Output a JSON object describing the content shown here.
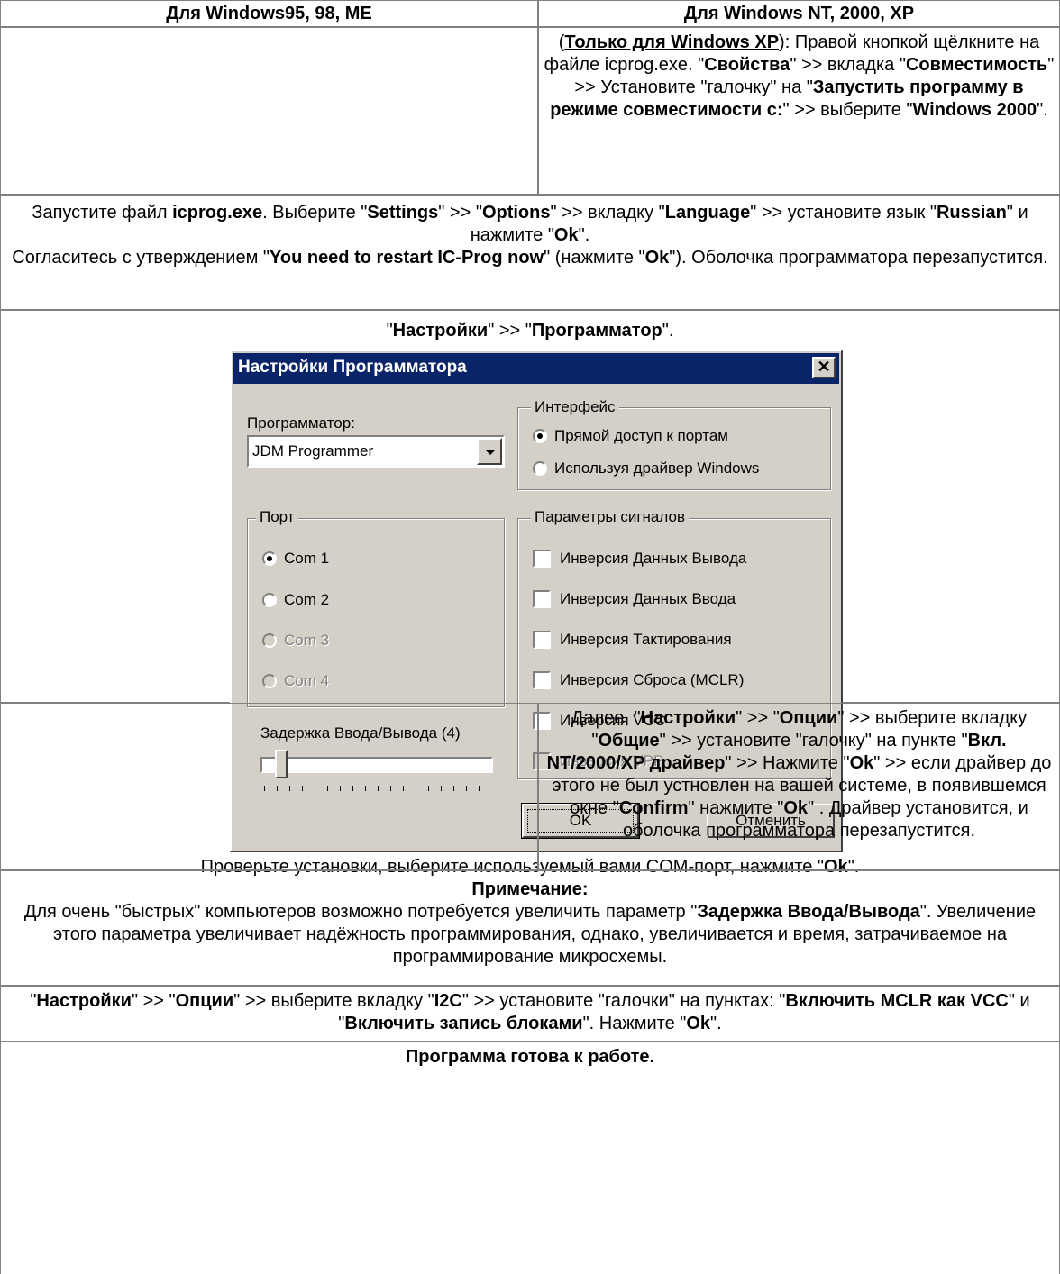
{
  "table": {
    "col1_header": "Для Windows95, 98, ME",
    "col2_header": "Для Windows NT, 2000, XP",
    "xp_note": {
      "open_paren": "(",
      "only_xp": "Только для Windows XP",
      "after_only": "): Правой кнопкой щёлкните на файле icprog.exe. \"",
      "props": "Свойства",
      "t2": "\" >> вкладка \"",
      "compat": "Совместимость",
      "t3": "\" >> Установите \"галочку\" на \"",
      "run_compat": "Запустить программу в режиме совместимости с:",
      "t4": "\" >> выберите \"",
      "win2000": "Windows 2000",
      "t5": "\"."
    },
    "step1": {
      "a": "Запустите файл ",
      "icprog": "icprog.exe",
      "b": ". Выберите \"",
      "settings": "Settings",
      "c": "\" >> \"",
      "options": "Options",
      "d": "\" >> вкладку \"",
      "language": "Language",
      "e": "\" >> установите язык \"",
      "russian": "Russian",
      "f": "\" и нажмите \"",
      "ok": "Ok",
      "g": "\".",
      "h": "Согласитесь с утверждением \"",
      "restart": "You need to restart IC-Prog now",
      "i": "\" (нажмите \"",
      "ok2": "Ok",
      "j": "\"). Оболочка программатора перезапустится."
    },
    "step2": {
      "q1": "\"",
      "settings": "Настройки",
      "mid": "\" >> \"",
      "programmer": "Программатор",
      "end": "\".",
      "caption_a": "Проверьте установки, выберите используемый вами COM-порт, нажмите \"",
      "caption_ok": "Ok",
      "caption_b": "\"."
    },
    "step3": {
      "a": "Далее, \"",
      "settings": "Настройки",
      "b": "\" >> \"",
      "options": "Опции",
      "c": "\" >> выберите вкладку \"",
      "general": "Общие",
      "d": "\" >> установите \"галочку\" на пункте \"",
      "driver": "Вкл. NT/2000/XP драйвер",
      "e": "\" >> Нажмите \"",
      "ok": "Ok",
      "f": "\" >> если драйвер до этого не был устновлен на вашей системе, в появившемся окне \"",
      "confirm": "Confirm",
      "g": "\" нажмите \"",
      "ok2": "Ok",
      "h": "\" . Драйвер установится, и оболочка программатора перезапустится."
    },
    "note": {
      "title": "Примечание:",
      "a": "Для очень \"быстрых\" компьютеров возможно потребуется увеличить параметр \"",
      "delay": "Задержка Ввода/Вывода",
      "b": "\". Увеличение этого параметра увеличивает надёжность программирования, однако, увеличивается и время, затрачиваемое на программирование микросхемы."
    },
    "step4": {
      "a": "\"",
      "settings": "Настройки",
      "b": "\" >> \"",
      "options": "Опции",
      "c": "\" >> выберите вкладку \"",
      "i2c": "I2C",
      "d": "\" >> установите \"галочки\" на пунктах: \"",
      "mclr": "Включить MCLR как VCC",
      "e": "\" и \"",
      "blocks": "Включить запись блоками",
      "f": "\". Нажмите \"",
      "ok": "Ok",
      "g": "\"."
    },
    "ready": "Программа готова к работе."
  },
  "dialog": {
    "title": "Настройки Программатора",
    "close_glyph": "✕",
    "programmer_label": "Программатор:",
    "programmer_value": "JDM Programmer",
    "interface_group": "Интерфейс",
    "interface_direct": "Прямой доступ к портам",
    "interface_driver": "Используя драйвер Windows",
    "port_group": "Порт",
    "ports": [
      "Com 1",
      "Com 2",
      "Com 3",
      "Com 4"
    ],
    "signals_group": "Параметры сигналов",
    "signals": [
      "Инверсия Данных Вывода",
      "Инверсия Данных Ввода",
      "Инверсия Тактирования",
      "Инверсия Сброса (MCLR)",
      "Инверсия VCC",
      "Инверсия VPP"
    ],
    "delay_label": "Задержка Ввода/Вывода (4)",
    "ok_button": "OK",
    "cancel_button": "Отменить"
  }
}
